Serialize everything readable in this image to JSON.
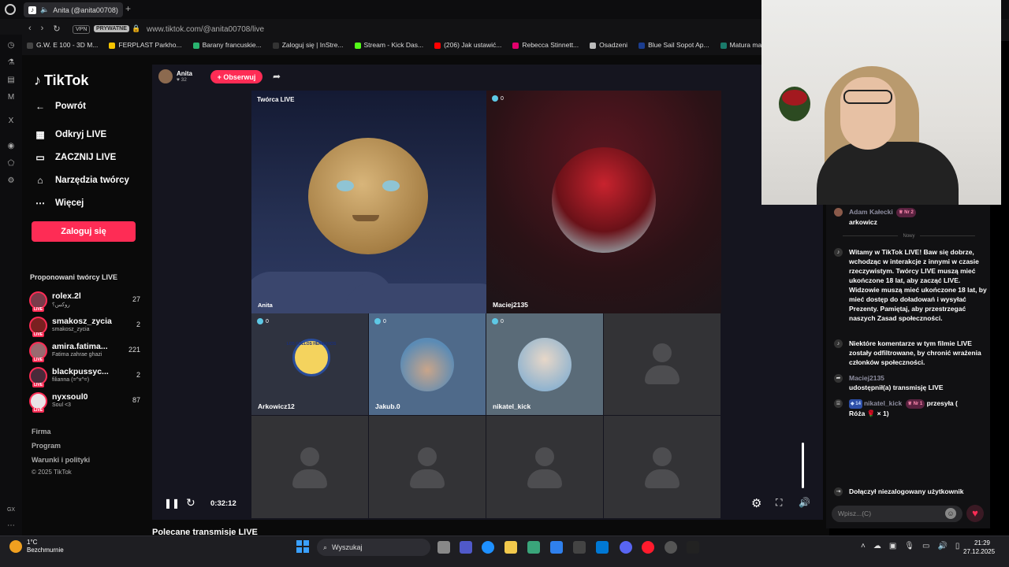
{
  "browser": {
    "tab_title": "Anita (@anita00708)",
    "url": "www.tiktok.com/@anita00708/live",
    "vpn_label": "VPN",
    "private_label": "PRYWATNE",
    "bookmarks": [
      {
        "label": "G.W. E 100 - 3D M...",
        "color": "#444"
      },
      {
        "label": "FERPLAST Parkho...",
        "color": "#f5c400"
      },
      {
        "label": "Barany francuskie...",
        "color": "#29b36f"
      },
      {
        "label": "Zaloguj się | InStre...",
        "color": "#333"
      },
      {
        "label": "Stream - Kick Das...",
        "color": "#53fc18"
      },
      {
        "label": "(206) Jak ustawić...",
        "color": "#ff0000"
      },
      {
        "label": "Rebecca Stinnett...",
        "color": "#e3006d"
      },
      {
        "label": "Osadzeni",
        "color": "#bbb"
      },
      {
        "label": "Blue Sail Sopot Ap...",
        "color": "#1b3d8f"
      },
      {
        "label": "Matura mate",
        "color": "#1a7a6a"
      }
    ]
  },
  "tiktok": {
    "logo": "TikTok",
    "nav": {
      "back": "Powrót",
      "discover": "Odkryj LIVE",
      "start": "ZACZNIJ LIVE",
      "tools": "Narzędzia twórcy",
      "more": "Więcej"
    },
    "login": "Zaloguj się",
    "suggested_title": "Proponowani twórcy LIVE",
    "creators": [
      {
        "name": "rolex.2l",
        "sub": "روکس؟",
        "count": "27"
      },
      {
        "name": "smakosz_zycia",
        "sub": "smakosz_zycia",
        "count": "2"
      },
      {
        "name": "amira.fatima...",
        "sub": "Fatima zahrae ghazi",
        "count": "221"
      },
      {
        "name": "blackpussyc...",
        "sub": "filianna (=^x^=)",
        "count": "2"
      },
      {
        "name": "nyxsoul0",
        "sub": "Soul <3",
        "count": "87"
      }
    ],
    "footer": {
      "company": "Firma",
      "program": "Program",
      "terms": "Warunki i polityki",
      "copyright": "© 2025 TikTok"
    }
  },
  "live": {
    "host_name": "Anita",
    "host_count": "32",
    "follow": "+ Obserwuj",
    "host_tag": "Twórca LIVE",
    "tiles": {
      "anita": "Anita",
      "maciej": "Maciej2135",
      "maciej_count": "0",
      "arkowicz": "Arkowicz12",
      "arkowicz_count": "0",
      "jakub": "Jakub.0",
      "jakub_count": "0",
      "nikatel": "nikatel_kick",
      "nikatel_count": "0"
    },
    "logo_text": "LOS POLLOS HERMANOS",
    "time": "0:32:12",
    "recommended": "Polecane transmisje LIVE"
  },
  "chat": {
    "msg1_user": "Adam Kałecki",
    "msg1_nr": "Nr 2",
    "msg1_text": "arkowicz",
    "new_divider": "Nowy",
    "welcome": "Witamy w TikTok LIVE! Baw się dobrze, wchodząc w interakcje z innymi w czasie rzeczywistym. Twórcy LIVE muszą mieć ukończone 18 lat, aby zacząć LIVE. Widzowie muszą mieć ukończone 18 lat, by mieć dostęp do doładowań i wysyłać Prezenty. Pamiętaj, aby przestrzegać naszych Zasad społeczności.",
    "filtered": "Niektóre komentarze w tym filmie LIVE zostały odfiltrowane, by chronić wrażenia członków społeczności.",
    "share_user": "Maciej2135",
    "share_text": "udostępnił(a) transmisję LIVE",
    "gift_level": "14",
    "gift_user": "nikatel_kick",
    "gift_nr": "Nr 1",
    "gift_action": "przesyła (",
    "gift_item": "Róża",
    "gift_count": "× 1)",
    "joined": "Dołączył niezalogowany użytkownik",
    "input_placeholder": "Wpisz...(C)"
  },
  "taskbar": {
    "temp": "1°C",
    "weather": "Bezchmurnie",
    "search": "Wyszukaj",
    "time": "21:29",
    "date": "27.12.2025"
  }
}
